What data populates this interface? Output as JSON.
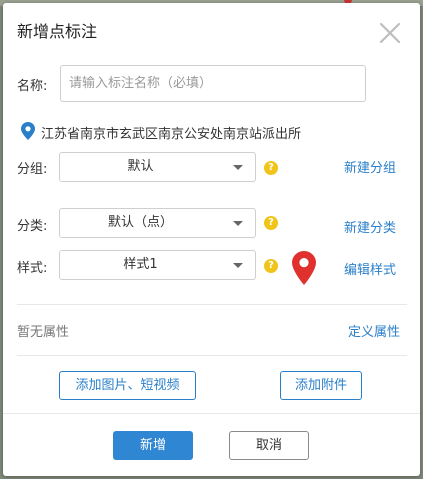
{
  "dialog": {
    "title": "新增点标注"
  },
  "name": {
    "label": "名称:",
    "placeholder": "请输入标注名称（必填）",
    "value": ""
  },
  "location": {
    "icon": "location-pin-icon",
    "text": "江苏省南京市玄武区南京公安处南京站派出所"
  },
  "group": {
    "label": "分组:",
    "selected": "默认",
    "create_link": "新建分组"
  },
  "category": {
    "label": "分类:",
    "selected": "默认（点）",
    "create_link": "新建分类"
  },
  "style": {
    "label": "样式:",
    "selected": "样式1",
    "edit_link": "编辑样式",
    "marker_color": "#e0312f"
  },
  "attributes": {
    "empty_text": "暂无属性",
    "define_link": "定义属性"
  },
  "media": {
    "add_media_button": "添加图片、短视频",
    "add_attachment_button": "添加附件"
  },
  "footer": {
    "submit_button": "新增",
    "cancel_button": "取消"
  },
  "colors": {
    "accent": "#2a7fc9",
    "help_badge": "#f0c419",
    "primary_button": "#2f86d2"
  }
}
